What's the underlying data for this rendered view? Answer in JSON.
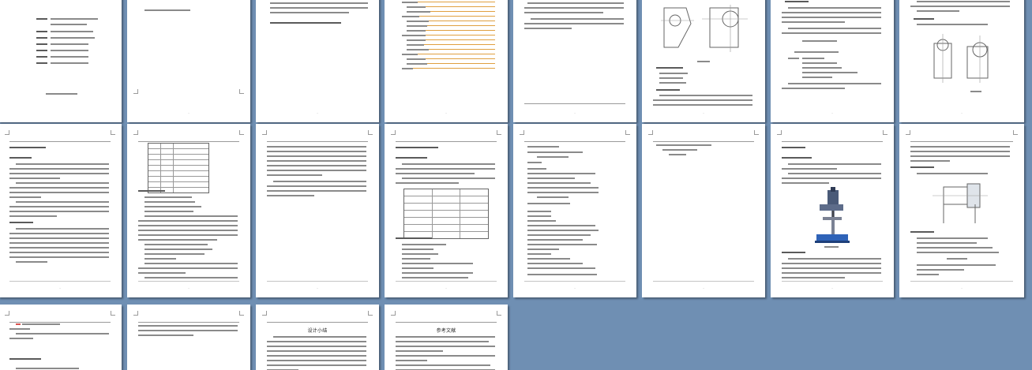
{
  "viewer": {
    "background": "#6f8fb3"
  },
  "pages": [
    {
      "heading": ""
    },
    {
      "heading": ""
    },
    {
      "heading": ""
    },
    {
      "heading": ""
    },
    {
      "heading": ""
    },
    {
      "heading": ""
    },
    {
      "heading": ""
    },
    {
      "heading": ""
    },
    {
      "heading": ""
    },
    {
      "heading": ""
    },
    {
      "heading": ""
    },
    {
      "heading": ""
    },
    {
      "heading": ""
    },
    {
      "heading": ""
    },
    {
      "heading": ""
    },
    {
      "heading": ""
    },
    {
      "heading": ""
    },
    {
      "heading": ""
    },
    {
      "heading": "设计小结"
    },
    {
      "heading": "参考文献"
    }
  ]
}
